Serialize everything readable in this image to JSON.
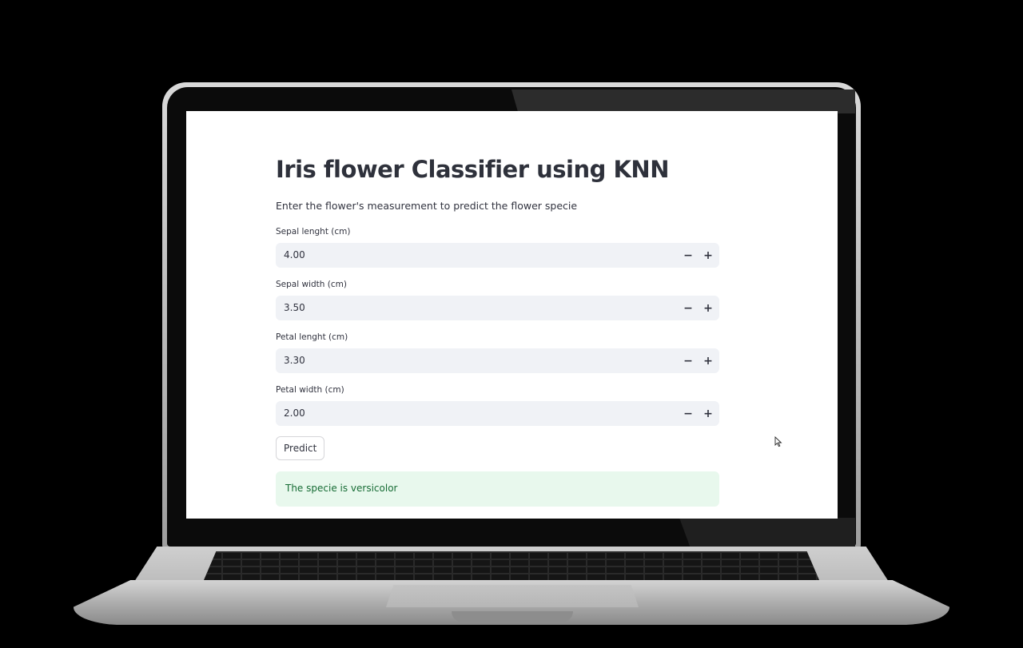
{
  "app": {
    "title": "Iris flower Classifier using KNN",
    "subtitle": "Enter the flower's measurement to predict the flower specie"
  },
  "inputs": [
    {
      "label": "Sepal lenght (cm)",
      "value": "4.00"
    },
    {
      "label": "Sepal width (cm)",
      "value": "3.50"
    },
    {
      "label": "Petal lenght (cm)",
      "value": "3.30"
    },
    {
      "label": "Petal width (cm)",
      "value": "2.00"
    }
  ],
  "stepper": {
    "minus": "−",
    "plus": "+"
  },
  "predict_button": "Predict",
  "result": "The specie is versicolor",
  "colors": {
    "text": "#31333f",
    "input_bg": "#f0f2f6",
    "success_bg": "#e8f8ed",
    "success_text": "#176c35"
  }
}
